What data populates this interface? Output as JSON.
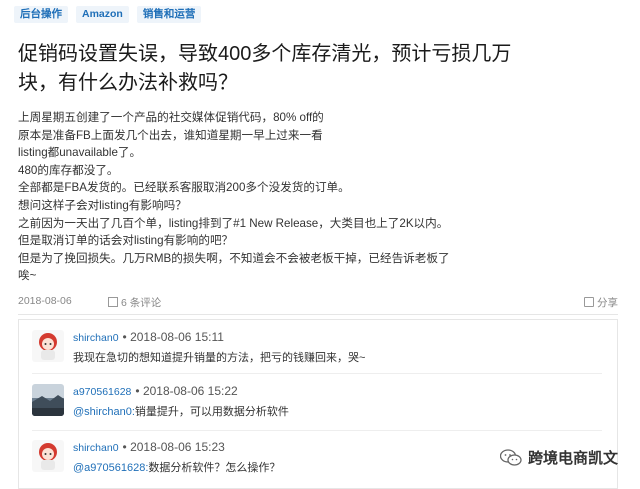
{
  "tags": [
    "后台操作",
    "Amazon",
    "销售和运营"
  ],
  "post": {
    "title_line1": "促销码设置失误，导致400多个库存清光，预计亏损几万",
    "title_line2": "块，有什么办法补救吗？",
    "body": [
      "上周星期五创建了一个产品的社交媒体促销代码，80% off的",
      "原本是准备FB上面发几个出去，谁知道星期一早上过来一看",
      "listing都unavailable了。",
      "480的库存都没了。",
      "全部都是FBA发货的。已经联系客服取消200多个没发货的订单。",
      "想问这样子会对listing有影响吗？",
      "之前因为一天出了几百个单，listing排到了#1 New Release，大类目也上了2K以内。",
      "但是取消订单的话会对listing有影响的吧？",
      "但是为了挽回损失。几万RMB的损失啊，不知道会不会被老板干掉，已经告诉老板了",
      "唉~"
    ],
    "date": "2018-08-06",
    "comments_label": "6 条评论",
    "share_label": "分享"
  },
  "comments": [
    {
      "user": "shirchan0",
      "time": "• 2018-08-06 15:11",
      "mention": "",
      "text": "我现在急切的想知道提升销量的方法，把亏的钱赚回来，哭~",
      "avatar": "red-girl"
    },
    {
      "user": "a970561628",
      "time": "• 2018-08-06 15:22",
      "mention": "@shirchan0:",
      "text": "销量提升，可以用数据分析软件",
      "avatar": "landscape"
    },
    {
      "user": "shirchan0",
      "time": "• 2018-08-06 15:23",
      "mention": "@a970561628:",
      "text": "数据分析软件？怎么操作？",
      "avatar": "red-girl"
    }
  ],
  "watermark": {
    "text": "跨境电商凯文",
    "icon": "wechat-icon"
  },
  "colors": {
    "link": "#1f6fb8",
    "tag_bg": "#eef4fa",
    "text": "#333333",
    "meta": "#888888"
  }
}
